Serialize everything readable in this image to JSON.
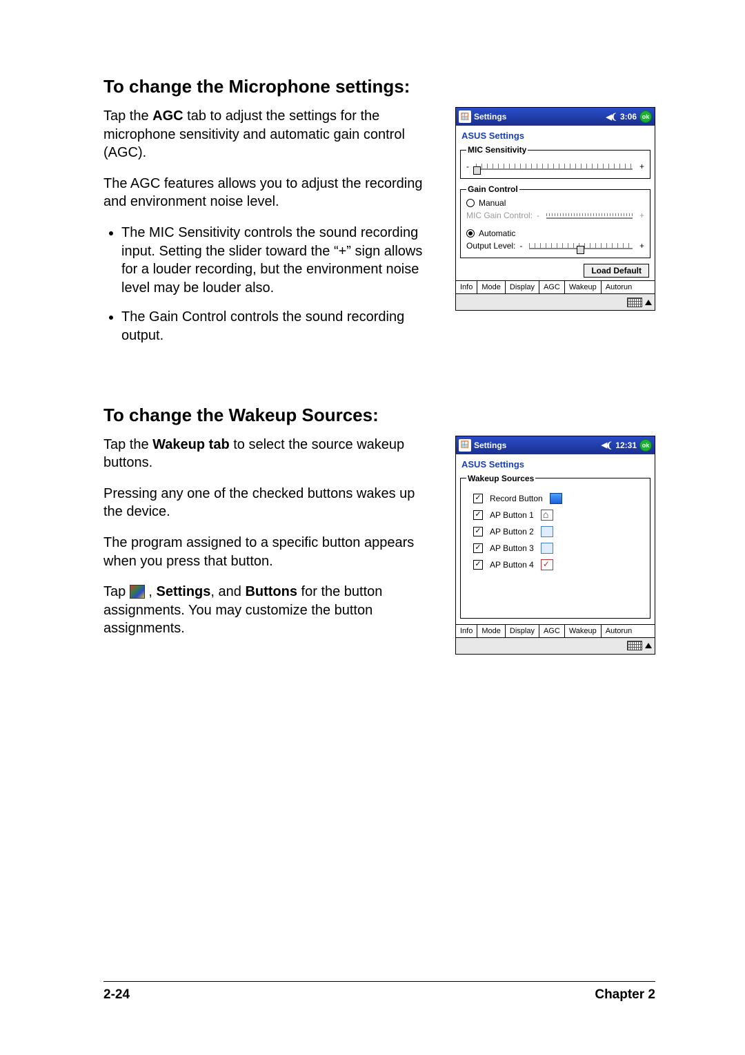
{
  "section1": {
    "heading": "To change the Microphone settings:",
    "p1_a": "Tap the ",
    "p1_bold": "AGC",
    "p1_b": " tab to adjust the settings for the microphone sensitivity and automatic gain control (AGC).",
    "p2": "The AGC features allows you to adjust the recording and environment noise level.",
    "b1": "The MIC Sensitivity controls the sound recording input. Setting the slider toward the “+” sign allows for a louder recording, but the environment noise level may be louder also.",
    "b2": "The Gain Control controls the sound recording output."
  },
  "section2": {
    "heading": "To change the Wakeup Sources:",
    "p1_a": "Tap the ",
    "p1_bold": "Wakeup tab",
    "p1_b": " to select the source wakeup buttons.",
    "p2": "Pressing any one of the checked buttons wakes up the device.",
    "p3": "The program assigned to a specific button appears when you press that button.",
    "p4_a": "Tap ",
    "p4_b": " , ",
    "p4_bold1": "Settings",
    "p4_c": ", and ",
    "p4_bold2": "Buttons",
    "p4_d": " for the button assignments. You may customize the button assignments."
  },
  "ppc_common": {
    "title": "Settings",
    "app": "ASUS Settings",
    "ok": "ok",
    "tabs": [
      "Info",
      "Mode",
      "Display",
      "AGC",
      "Wakeup",
      "Autorun"
    ]
  },
  "ppc1": {
    "time": "3:06",
    "mic_legend": "MIC Sensitivity",
    "gain_legend": "Gain Control",
    "manual": "Manual",
    "mic_gain": "MIC Gain Control:",
    "automatic": "Automatic",
    "output_level": "Output Level:",
    "minus": "-",
    "plus": "+",
    "load_default": "Load Default"
  },
  "ppc2": {
    "time": "12:31",
    "wakeup_legend": "Wakeup Sources",
    "items": [
      "Record Button",
      "AP Button 1",
      "AP Button 2",
      "AP Button 3",
      "AP Button 4"
    ]
  },
  "footer": {
    "left": "2-24",
    "right": "Chapter 2"
  }
}
